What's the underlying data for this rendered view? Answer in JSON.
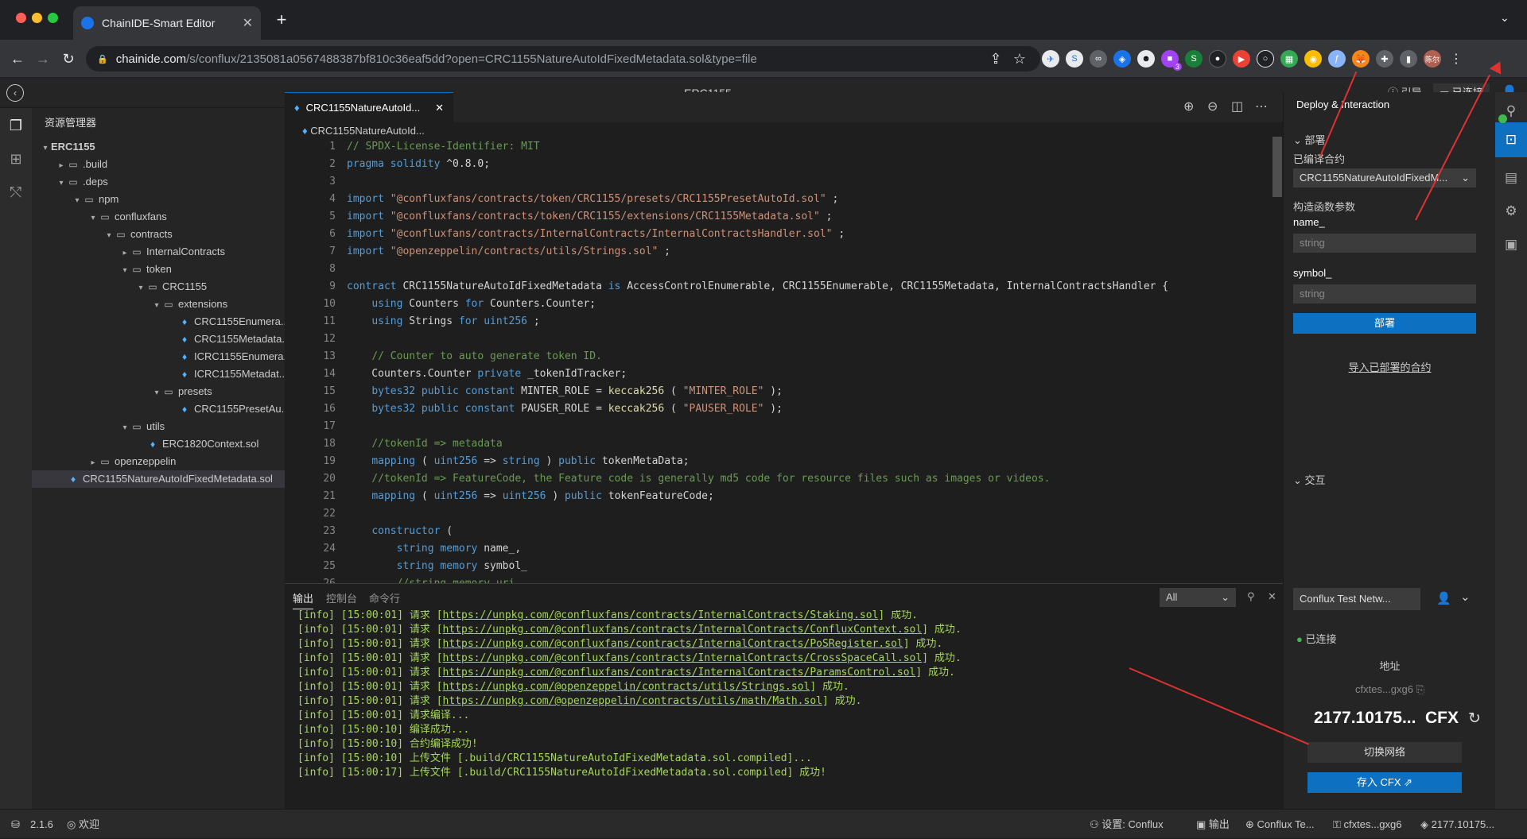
{
  "browser": {
    "tab_title": "ChainIDE-Smart Editor",
    "url_host": "chainide.com",
    "url_path": "/s/conflux/2135081a0567488387bf810c36eaf5dd?open=CRC1155NatureAutoIdFixedMetadata.sol&type=file",
    "ext_badge": "3",
    "profile": "陈尔"
  },
  "app": {
    "title": "ERC1155",
    "guide": "引导",
    "connected": "已连接"
  },
  "explorer": {
    "header": "资源管理器",
    "items": [
      {
        "label": "ERC1155",
        "level": 0,
        "type": "root",
        "open": true
      },
      {
        "label": ".build",
        "level": 1,
        "type": "folder",
        "open": false
      },
      {
        "label": ".deps",
        "level": 1,
        "type": "folder",
        "open": true
      },
      {
        "label": "npm",
        "level": 2,
        "type": "folder",
        "open": true
      },
      {
        "label": "confluxfans",
        "level": 3,
        "type": "folder",
        "open": true
      },
      {
        "label": "contracts",
        "level": 4,
        "type": "folder",
        "open": true
      },
      {
        "label": "InternalContracts",
        "level": 5,
        "type": "folder",
        "open": false
      },
      {
        "label": "token",
        "level": 5,
        "type": "folder",
        "open": true
      },
      {
        "label": "CRC1155",
        "level": 6,
        "type": "folder",
        "open": true
      },
      {
        "label": "extensions",
        "level": 7,
        "type": "folder",
        "open": true
      },
      {
        "label": "CRC1155Enumera...",
        "level": 8,
        "type": "file"
      },
      {
        "label": "CRC1155Metadata...",
        "level": 8,
        "type": "file"
      },
      {
        "label": "ICRC1155Enumera...",
        "level": 8,
        "type": "file"
      },
      {
        "label": "ICRC1155Metadat...",
        "level": 8,
        "type": "file"
      },
      {
        "label": "presets",
        "level": 7,
        "type": "folder",
        "open": true
      },
      {
        "label": "CRC1155PresetAu...",
        "level": 8,
        "type": "file"
      },
      {
        "label": "utils",
        "level": 5,
        "type": "folder",
        "open": true
      },
      {
        "label": "ERC1820Context.sol",
        "level": 6,
        "type": "file"
      },
      {
        "label": "openzeppelin",
        "level": 3,
        "type": "folder",
        "open": false
      },
      {
        "label": "CRC1155NatureAutoIdFixedMetadata.sol",
        "level": 1,
        "type": "file",
        "selected": true
      }
    ]
  },
  "editor": {
    "tab_label": "CRC1155NatureAutoId...",
    "breadcrumb": "CRC1155NatureAutoId...",
    "lines": [
      [
        [
          "c-com",
          "// SPDX-License-Identifier: MIT"
        ]
      ],
      [
        [
          "c-kw",
          "pragma solidity"
        ],
        [
          "",
          "^0.8.0;"
        ]
      ],
      [],
      [
        [
          "c-kw",
          "import"
        ],
        [
          "c-str",
          "\"@confluxfans/contracts/token/CRC1155/presets/CRC1155PresetAutoId.sol\""
        ],
        [
          "",
          ";"
        ]
      ],
      [
        [
          "c-kw",
          "import"
        ],
        [
          "c-str",
          "\"@confluxfans/contracts/token/CRC1155/extensions/CRC1155Metadata.sol\""
        ],
        [
          "",
          ";"
        ]
      ],
      [
        [
          "c-kw",
          "import"
        ],
        [
          "c-str",
          "\"@confluxfans/contracts/InternalContracts/InternalContractsHandler.sol\""
        ],
        [
          "",
          ";"
        ]
      ],
      [
        [
          "c-kw",
          "import"
        ],
        [
          "c-str",
          "\"@openzeppelin/contracts/utils/Strings.sol\""
        ],
        [
          "",
          ";"
        ]
      ],
      [],
      [
        [
          "c-kw",
          "contract"
        ],
        [
          "",
          "CRC1155NatureAutoIdFixedMetadata"
        ],
        [
          "c-kw",
          "is"
        ],
        [
          "",
          "AccessControlEnumerable, CRC1155Enumerable, CRC1155Metadata, InternalContractsHandler {"
        ]
      ],
      [
        [
          "",
          "    "
        ],
        [
          "c-kw",
          "using"
        ],
        [
          "",
          "Counters"
        ],
        [
          "c-kw",
          "for"
        ],
        [
          "",
          "Counters.Counter;"
        ]
      ],
      [
        [
          "",
          "    "
        ],
        [
          "c-kw",
          "using"
        ],
        [
          "",
          "Strings"
        ],
        [
          "c-kw",
          "for"
        ],
        [
          "c-kw",
          "uint256"
        ],
        [
          "",
          ";"
        ]
      ],
      [],
      [
        [
          "",
          "    "
        ],
        [
          "c-com",
          "// Counter to auto generate token ID."
        ]
      ],
      [
        [
          "",
          "    Counters.Counter"
        ],
        [
          "c-kw",
          "private"
        ],
        [
          "",
          "_tokenIdTracker;"
        ]
      ],
      [
        [
          "",
          "    "
        ],
        [
          "c-kw",
          "bytes32 public constant"
        ],
        [
          "",
          "MINTER_ROLE ="
        ],
        [
          "c-fn",
          "keccak256"
        ],
        [
          "",
          "("
        ],
        [
          "c-str",
          "\"MINTER_ROLE\""
        ],
        [
          "",
          ");"
        ]
      ],
      [
        [
          "",
          "    "
        ],
        [
          "c-kw",
          "bytes32 public constant"
        ],
        [
          "",
          "PAUSER_ROLE ="
        ],
        [
          "c-fn",
          "keccak256"
        ],
        [
          "",
          "("
        ],
        [
          "c-str",
          "\"PAUSER_ROLE\""
        ],
        [
          "",
          ");"
        ]
      ],
      [],
      [
        [
          "",
          "    "
        ],
        [
          "c-com",
          "//tokenId => metadata"
        ]
      ],
      [
        [
          "",
          "    "
        ],
        [
          "c-kw",
          "mapping"
        ],
        [
          "",
          "("
        ],
        [
          "c-kw",
          "uint256"
        ],
        [
          "",
          "=>"
        ],
        [
          "c-kw",
          "string"
        ],
        [
          "",
          ")"
        ],
        [
          "c-kw",
          "public"
        ],
        [
          "",
          "tokenMetaData;"
        ]
      ],
      [
        [
          "",
          "    "
        ],
        [
          "c-com",
          "//tokenId => FeatureCode, the Feature code is generally md5 code for resource files such as images or videos."
        ]
      ],
      [
        [
          "",
          "    "
        ],
        [
          "c-kw",
          "mapping"
        ],
        [
          "",
          "("
        ],
        [
          "c-kw",
          "uint256"
        ],
        [
          "",
          "=>"
        ],
        [
          "c-kw",
          "uint256"
        ],
        [
          "",
          ")"
        ],
        [
          "c-kw",
          "public"
        ],
        [
          "",
          "tokenFeatureCode;"
        ]
      ],
      [],
      [
        [
          "",
          "    "
        ],
        [
          "c-kw",
          "constructor"
        ],
        [
          "",
          "("
        ]
      ],
      [
        [
          "",
          "        "
        ],
        [
          "c-kw",
          "string memory"
        ],
        [
          "",
          "name_,"
        ]
      ],
      [
        [
          "",
          "        "
        ],
        [
          "c-kw",
          "string memory"
        ],
        [
          "",
          "symbol_"
        ]
      ],
      [
        [
          "",
          "        "
        ],
        [
          "c-com",
          "//string memory uri"
        ]
      ]
    ]
  },
  "panel": {
    "tabs": [
      "输出",
      "控制台",
      "命令行"
    ],
    "filter": "All",
    "lines": [
      {
        "p": "[info] [15:00:01] 请求 [",
        "u": "https://unpkg.com/@confluxfans/contracts/InternalContracts/Staking.sol",
        "s": "] 成功."
      },
      {
        "p": "[info] [15:00:01] 请求 [",
        "u": "https://unpkg.com/@confluxfans/contracts/InternalContracts/ConfluxContext.sol",
        "s": "] 成功."
      },
      {
        "p": "[info] [15:00:01] 请求 [",
        "u": "https://unpkg.com/@confluxfans/contracts/InternalContracts/PoSRegister.sol",
        "s": "] 成功."
      },
      {
        "p": "[info] [15:00:01] 请求 [",
        "u": "https://unpkg.com/@confluxfans/contracts/InternalContracts/CrossSpaceCall.sol",
        "s": "] 成功."
      },
      {
        "p": "[info] [15:00:01] 请求 [",
        "u": "https://unpkg.com/@confluxfans/contracts/InternalContracts/ParamsControl.sol",
        "s": "] 成功."
      },
      {
        "p": "[info] [15:00:01] 请求 [",
        "u": "https://unpkg.com/@openzeppelin/contracts/utils/Strings.sol",
        "s": "] 成功."
      },
      {
        "p": "[info] [15:00:01] 请求 [",
        "u": "https://unpkg.com/@openzeppelin/contracts/utils/math/Math.sol",
        "s": "] 成功."
      },
      {
        "p": "[info] [15:00:01] 请求编译...",
        "u": "",
        "s": ""
      },
      {
        "p": "[info] [15:00:10] 编译成功...",
        "u": "",
        "s": ""
      },
      {
        "p": "[info] [15:00:10] 合约编译成功!",
        "u": "",
        "s": ""
      },
      {
        "p": "[info] [15:00:10] 上传文件 [.build/CRC1155NatureAutoIdFixedMetadata.sol.compiled]...",
        "u": "",
        "s": ""
      },
      {
        "p": "[info] [15:00:17] 上传文件 [.build/CRC1155NatureAutoIdFixedMetadata.sol.compiled] 成功!",
        "u": "",
        "s": ""
      }
    ]
  },
  "deploy": {
    "title": "Deploy & Interaction",
    "section_deploy": "部署",
    "compiled_label": "已编译合约",
    "compiled_value": "CRC1155NatureAutoIdFixedM...",
    "ctor_label": "构造函数参数",
    "p1_label": "name_",
    "p1_placeholder": "string",
    "p2_label": "symbol_",
    "p2_placeholder": "string",
    "deploy_btn": "部署",
    "import_link": "导入已部署的合约",
    "section_interact": "交互",
    "network": "Conflux Test Netw...",
    "status": "已连接",
    "addr_label": "地址",
    "addr_value": "cfxtes...gxg6",
    "balance": "2177.10175...",
    "unit": "CFX",
    "switch_btn": "切换网络",
    "deposit_btn": "存入 CFX"
  },
  "status": {
    "version": "2.1.6",
    "welcome": "欢迎",
    "settings": "设置: Conflux",
    "output": "输出",
    "network": "Conflux Te...",
    "account": "cfxtes...gxg6",
    "balance": "2177.10175..."
  },
  "colors": {
    "accent": "#0e70c0",
    "arrow": "#e03131",
    "ok": "#3fb950"
  }
}
